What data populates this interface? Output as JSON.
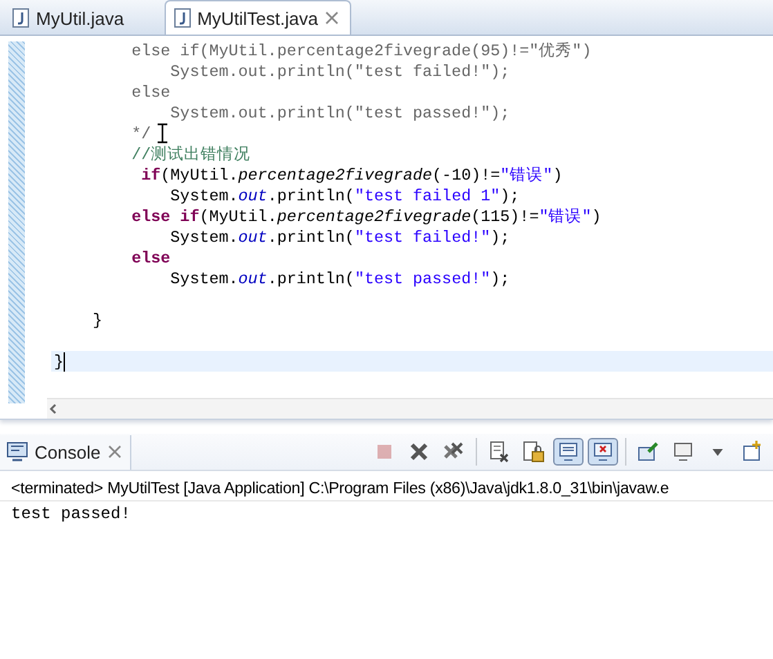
{
  "editor_tabs": [
    {
      "label": "MyUtil.java",
      "selected": false
    },
    {
      "label": "MyUtilTest.java",
      "selected": true
    }
  ],
  "code_lines": [
    {
      "current": false,
      "tokens": [
        {
          "kind": "block_comment",
          "text": "        else if(MyUtil.percentage2fivegrade(95)!=\"优秀\")"
        }
      ]
    },
    {
      "current": false,
      "tokens": [
        {
          "kind": "block_comment",
          "text": "            System.out.println(\"test failed!\");"
        }
      ]
    },
    {
      "current": false,
      "tokens": [
        {
          "kind": "block_comment",
          "text": "        else"
        }
      ]
    },
    {
      "current": false,
      "tokens": [
        {
          "kind": "block_comment",
          "text": "            System.out.println(\"test passed!\");"
        }
      ]
    },
    {
      "current": false,
      "tokens": [
        {
          "kind": "block_comment",
          "text": "        */"
        }
      ]
    },
    {
      "current": false,
      "tokens": [
        {
          "kind": "line_comment",
          "text": "        //测试出错情况"
        }
      ]
    },
    {
      "current": false,
      "tokens": [
        {
          "kind": "keyword",
          "text": "         if"
        },
        {
          "kind": "plain",
          "text": "(MyUtil."
        },
        {
          "kind": "static_method",
          "text": "percentage2fivegrade"
        },
        {
          "kind": "plain",
          "text": "(-10)!="
        },
        {
          "kind": "string",
          "text": "\"错误\""
        },
        {
          "kind": "plain",
          "text": ")"
        }
      ]
    },
    {
      "current": false,
      "tokens": [
        {
          "kind": "plain",
          "text": "            System."
        },
        {
          "kind": "static_field",
          "text": "out"
        },
        {
          "kind": "plain",
          "text": ".println("
        },
        {
          "kind": "string",
          "text": "\"test failed 1\""
        },
        {
          "kind": "plain",
          "text": ");"
        }
      ]
    },
    {
      "current": false,
      "tokens": [
        {
          "kind": "keyword",
          "text": "        else if"
        },
        {
          "kind": "plain",
          "text": "(MyUtil."
        },
        {
          "kind": "static_method",
          "text": "percentage2fivegrade"
        },
        {
          "kind": "plain",
          "text": "(115)!="
        },
        {
          "kind": "string",
          "text": "\"错误\""
        },
        {
          "kind": "plain",
          "text": ")"
        }
      ]
    },
    {
      "current": false,
      "tokens": [
        {
          "kind": "plain",
          "text": "            System."
        },
        {
          "kind": "static_field",
          "text": "out"
        },
        {
          "kind": "plain",
          "text": ".println("
        },
        {
          "kind": "string",
          "text": "\"test failed!\""
        },
        {
          "kind": "plain",
          "text": ");"
        }
      ]
    },
    {
      "current": false,
      "tokens": [
        {
          "kind": "keyword",
          "text": "        else"
        }
      ]
    },
    {
      "current": false,
      "tokens": [
        {
          "kind": "plain",
          "text": "            System."
        },
        {
          "kind": "static_field",
          "text": "out"
        },
        {
          "kind": "plain",
          "text": ".println("
        },
        {
          "kind": "string",
          "text": "\"test passed!\""
        },
        {
          "kind": "plain",
          "text": ");"
        }
      ]
    },
    {
      "current": false
    },
    {
      "current": false,
      "tokens": [
        {
          "kind": "plain",
          "text": "    }"
        }
      ]
    },
    {
      "current": false
    },
    {
      "current": true,
      "tokens": [
        {
          "kind": "plain",
          "text": "}"
        }
      ]
    }
  ],
  "console": {
    "tab": {
      "label": "Console"
    },
    "toolbar": [
      {
        "kind": "terminate",
        "disabled": true,
        "selected": false
      },
      {
        "kind": "remove_launch",
        "disabled": false,
        "selected": false
      },
      {
        "kind": "remove_all",
        "disabled": false,
        "selected": false
      },
      {
        "kind": "separator"
      },
      {
        "kind": "clear",
        "disabled": false,
        "selected": false
      },
      {
        "kind": "scroll_lock",
        "disabled": false,
        "selected": false
      },
      {
        "kind": "show_on_output",
        "disabled": false,
        "selected": true
      },
      {
        "kind": "show_on_error",
        "disabled": false,
        "selected": true
      },
      {
        "kind": "separator"
      },
      {
        "kind": "pin",
        "disabled": false,
        "selected": false
      },
      {
        "kind": "display",
        "disabled": false,
        "selected": false
      },
      {
        "kind": "dropdown",
        "disabled": false,
        "selected": false
      },
      {
        "kind": "open_console",
        "disabled": false,
        "selected": false
      }
    ],
    "status": "<terminated> MyUtilTest [Java Application] C:\\Program Files (x86)\\Java\\jdk1.8.0_31\\bin\\javaw.e",
    "output": [
      "test passed!"
    ]
  }
}
